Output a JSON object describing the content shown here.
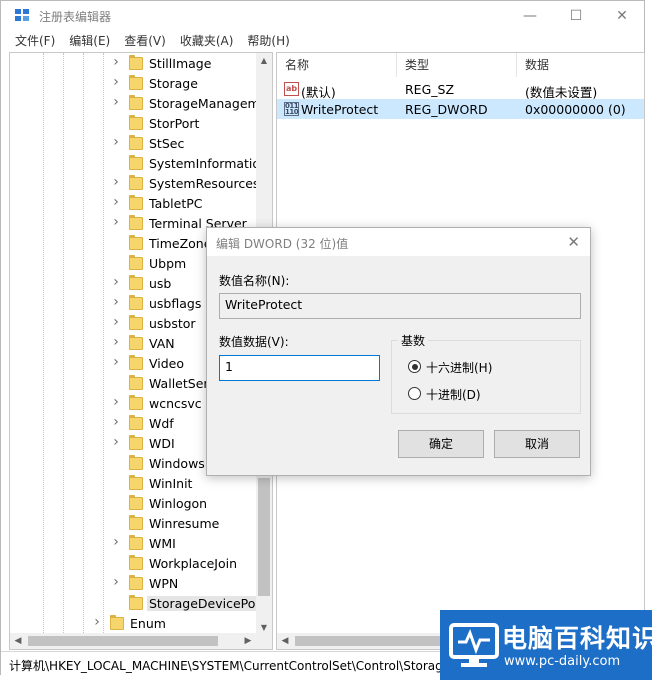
{
  "window": {
    "title": "注册表编辑器",
    "minimize_glyph": "—",
    "maximize_glyph": "☐",
    "close_glyph": "✕"
  },
  "menu": [
    "文件(F)",
    "编辑(E)",
    "查看(V)",
    "收藏夹(A)",
    "帮助(H)"
  ],
  "tree": {
    "items": [
      {
        "label": "StillImage",
        "expandable": true
      },
      {
        "label": "Storage",
        "expandable": true
      },
      {
        "label": "StorageManagem",
        "expandable": true
      },
      {
        "label": "StorPort",
        "expandable": false
      },
      {
        "label": "StSec",
        "expandable": true
      },
      {
        "label": "SystemInformation",
        "expandable": false
      },
      {
        "label": "SystemResources",
        "expandable": true
      },
      {
        "label": "TabletPC",
        "expandable": true
      },
      {
        "label": "Terminal Server",
        "expandable": true
      },
      {
        "label": "TimeZone",
        "expandable": false
      },
      {
        "label": "Ubpm",
        "expandable": false
      },
      {
        "label": "usb",
        "expandable": true
      },
      {
        "label": "usbflags",
        "expandable": true
      },
      {
        "label": "usbstor",
        "expandable": true
      },
      {
        "label": "VAN",
        "expandable": true
      },
      {
        "label": "Video",
        "expandable": true
      },
      {
        "label": "WalletServ",
        "expandable": false
      },
      {
        "label": "wcncsvc",
        "expandable": true
      },
      {
        "label": "Wdf",
        "expandable": true
      },
      {
        "label": "WDI",
        "expandable": true
      },
      {
        "label": "Windows",
        "expandable": false
      },
      {
        "label": "WinInit",
        "expandable": false
      },
      {
        "label": "Winlogon",
        "expandable": false
      },
      {
        "label": "Winresume",
        "expandable": false
      },
      {
        "label": "WMI",
        "expandable": true
      },
      {
        "label": "WorkplaceJoin",
        "expandable": false
      },
      {
        "label": "WPN",
        "expandable": true
      },
      {
        "label": "StorageDevicePoli",
        "expandable": false,
        "selected": true
      }
    ],
    "enum_item": {
      "label": "Enum",
      "expandable": true
    }
  },
  "values": {
    "headers": [
      "名称",
      "类型",
      "数据"
    ],
    "rows": [
      {
        "name": "(默认)",
        "type": "REG_SZ",
        "data": "(数值未设置)",
        "icon": "string-value-icon",
        "icon_text": "ab"
      },
      {
        "name": "WriteProtect",
        "type": "REG_DWORD",
        "data": "0x00000000 (0)",
        "icon": "binary-value-icon",
        "icon_text": "011 110",
        "selected": true
      }
    ]
  },
  "status_path": "计算机\\HKEY_LOCAL_MACHINE\\SYSTEM\\CurrentControlSet\\Control\\Storag",
  "dialog": {
    "title": "编辑 DWORD (32 位)值",
    "value_name_label": "数值名称(N):",
    "value_name": "WriteProtect",
    "value_data_label": "数值数据(V):",
    "value_data": "1",
    "base_label": "基数",
    "base_options": [
      "十六进制(H)",
      "十进制(D)"
    ],
    "base_selected": 0,
    "ok_label": "确定",
    "cancel_label": "取消"
  },
  "watermark": {
    "title": "电脑百科知识",
    "url": "www.pc-daily.com"
  },
  "colors": {
    "selection": "#cce8ff",
    "folder": "#f7d56d",
    "watermark_bg": "#1d6ec6"
  }
}
